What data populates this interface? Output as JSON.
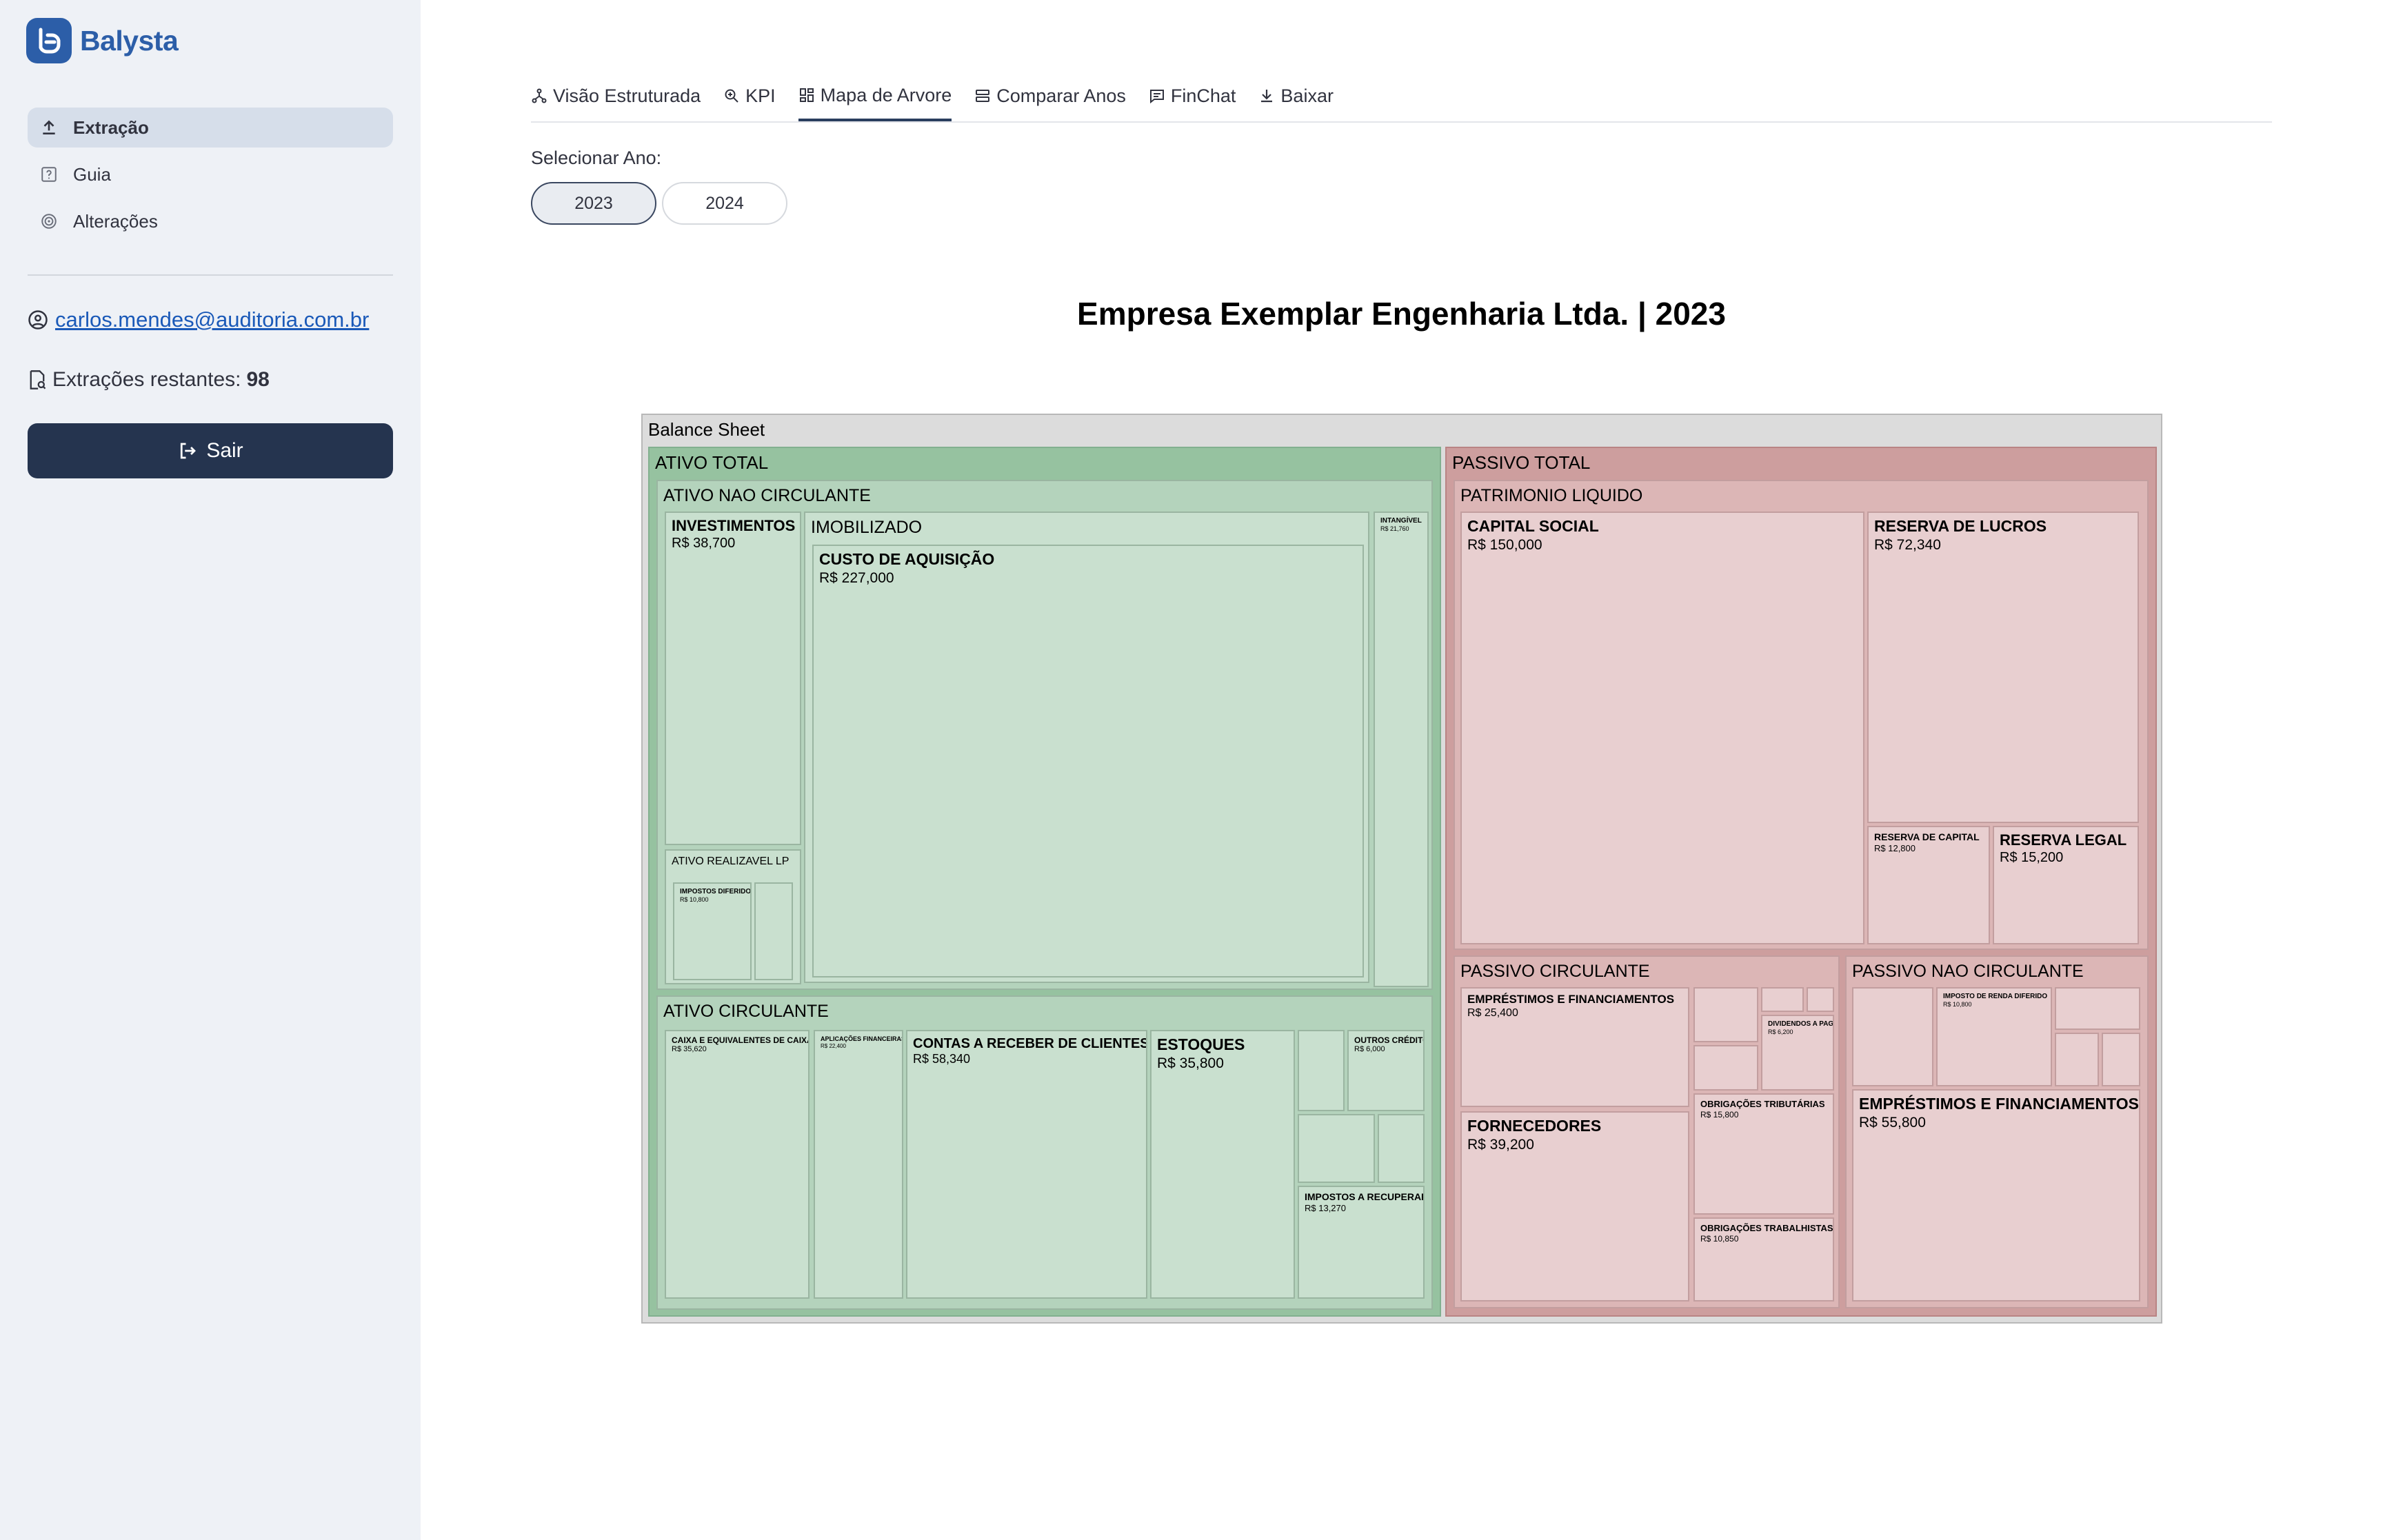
{
  "app": {
    "brand": "Balysta",
    "nav": [
      {
        "label": "Extração",
        "icon": "upload-icon",
        "active": true
      },
      {
        "label": "Guia",
        "icon": "help-square-icon",
        "active": false
      },
      {
        "label": "Alterações",
        "icon": "history-icon",
        "active": false
      }
    ],
    "user_email": "carlos.mendes@auditoria.com.br",
    "credits_label": "Extrações restantes:",
    "credits_value": "98",
    "logout_label": "Sair"
  },
  "tabs": [
    {
      "label": "Visão Estruturada",
      "icon": "hierarchy-icon"
    },
    {
      "label": "KPI",
      "icon": "zoom-icon"
    },
    {
      "label": "Mapa de Arvore",
      "icon": "grid-icon",
      "active": true
    },
    {
      "label": "Comparar Anos",
      "icon": "stack-icon"
    },
    {
      "label": "FinChat",
      "icon": "chat-icon"
    },
    {
      "label": "Baixar",
      "icon": "download-icon"
    }
  ],
  "year_selector": {
    "label": "Selecionar Ano:",
    "options": [
      "2023",
      "2024"
    ],
    "selected": "2023"
  },
  "chart_data": {
    "type": "treemap",
    "title": "Empresa Exemplar Engenharia Ltda. | 2023",
    "colors": {
      "root": "#dcdcdc",
      "asset": "#96c2a0",
      "asset_sub": "#b4d3bc",
      "asset_leaf": "#c9e0cf",
      "liab": "#cd9e9e",
      "liab_sub": "#dcb6b6",
      "liab_leaf": "#e8cfd0"
    },
    "root": {
      "name": "Balance Sheet",
      "children": [
        {
          "name": "ATIVO TOTAL",
          "children": [
            {
              "name": "ATIVO NAO CIRCULANTE",
              "children": [
                {
                  "name": "INVESTIMENTOS",
                  "value_label": "R$ 38,700"
                },
                {
                  "name": "ATIVO REALIZAVEL LP",
                  "children": [
                    {
                      "name": "IMPOSTOS DIFERIDOS",
                      "value_label": "R$ 10,800"
                    }
                  ]
                },
                {
                  "name": "IMOBILIZADO",
                  "children": [
                    {
                      "name": "CUSTO DE AQUISIÇÃO",
                      "value_label": "R$ 227,000"
                    }
                  ]
                },
                {
                  "name": "INTANGÍVEL",
                  "value_label": "R$ 21,760"
                }
              ]
            },
            {
              "name": "ATIVO CIRCULANTE",
              "children": [
                {
                  "name": "CAIXA E EQUIVALENTES DE CAIXA",
                  "value_label": "R$ 35,620"
                },
                {
                  "name": "APLICAÇÕES FINANCEIRAS",
                  "value_label": "R$ 22,400"
                },
                {
                  "name": "CONTAS A RECEBER DE CLIENTES",
                  "value_label": "R$ 58,340"
                },
                {
                  "name": "ESTOQUES",
                  "value_label": "R$ 35,800"
                },
                {
                  "name": "OUTROS CRÉDITOS",
                  "value_label": "R$ 6,000"
                },
                {
                  "name": "IMPOSTOS A RECUPERAR",
                  "value_label": "R$ 13,270"
                }
              ]
            }
          ]
        },
        {
          "name": "PASSIVO TOTAL",
          "children": [
            {
              "name": "PATRIMONIO LIQUIDO",
              "children": [
                {
                  "name": "CAPITAL SOCIAL",
                  "value_label": "R$ 150,000"
                },
                {
                  "name": "RESERVA DE LUCROS",
                  "value_label": "R$ 72,340"
                },
                {
                  "name": "RESERVA DE CAPITAL",
                  "value_label": "R$ 12,800"
                },
                {
                  "name": "RESERVA LEGAL",
                  "value_label": "R$ 15,200"
                }
              ]
            },
            {
              "name": "PASSIVO CIRCULANTE",
              "children": [
                {
                  "name": "EMPRÉSTIMOS E FINANCIAMENTOS",
                  "value_label": "R$ 25,400"
                },
                {
                  "name": "FORNECEDORES",
                  "value_label": "R$ 39,200"
                },
                {
                  "name": "DIVIDENDOS A PAGAR",
                  "value_label": "R$ 6,200"
                },
                {
                  "name": "OBRIGAÇÕES TRIBUTÁRIAS",
                  "value_label": "R$ 15,800"
                },
                {
                  "name": "OBRIGAÇÕES TRABALHISTAS",
                  "value_label": "R$ 10,850"
                }
              ]
            },
            {
              "name": "PASSIVO NAO CIRCULANTE",
              "children": [
                {
                  "name": "IMPOSTO DE RENDA DIFERIDO",
                  "value_label": "R$ 10,800"
                },
                {
                  "name": "EMPRÉSTIMOS E FINANCIAMENTOS",
                  "value_label": "R$ 55,800"
                }
              ]
            }
          ]
        }
      ]
    }
  }
}
